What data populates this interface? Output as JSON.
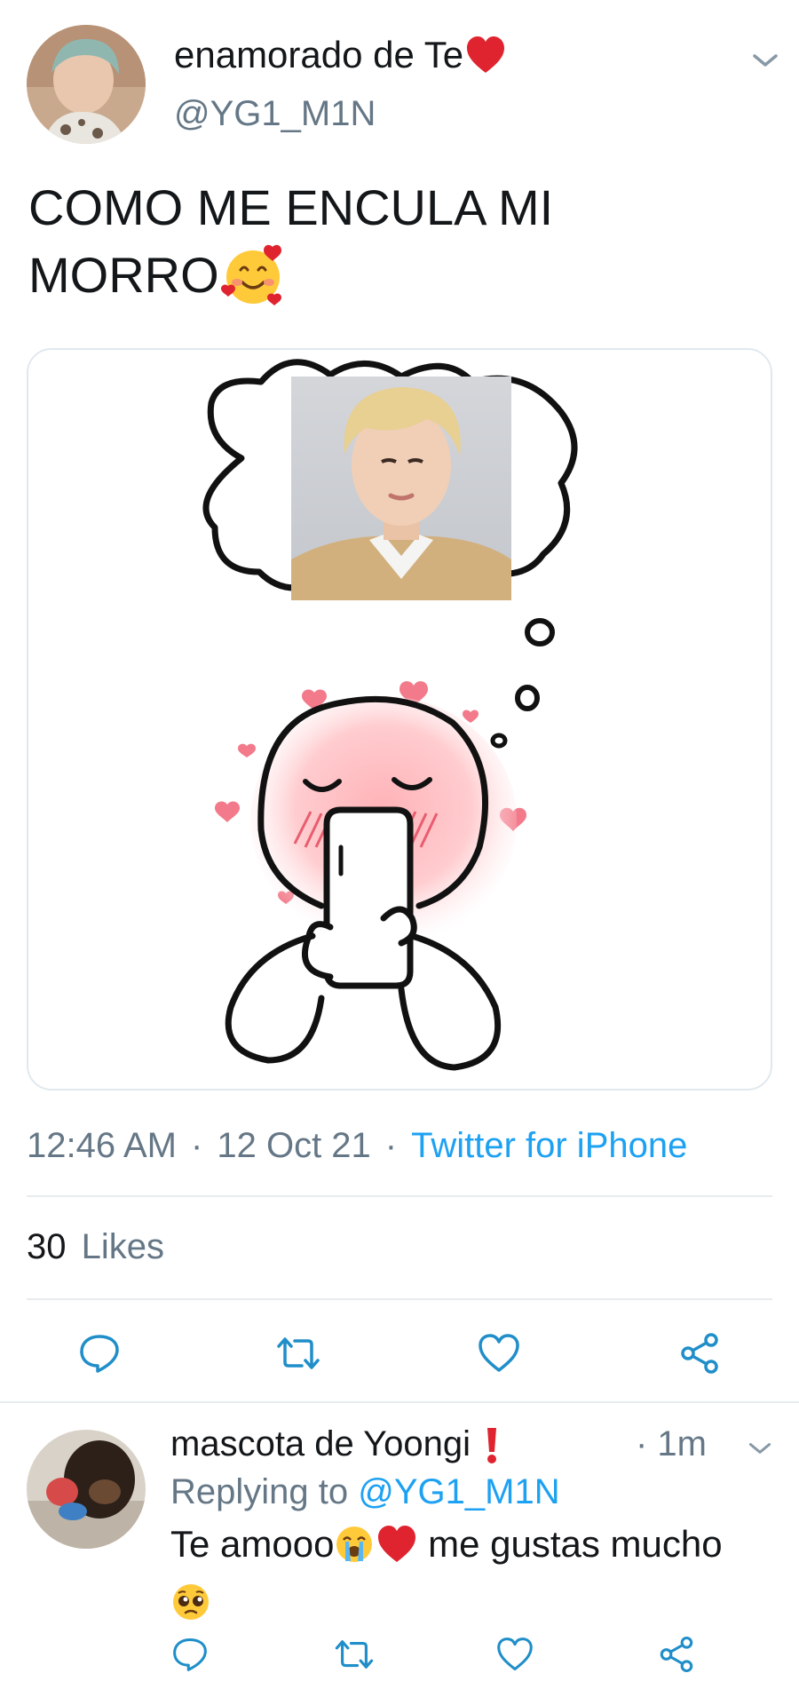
{
  "tweet": {
    "display_name": "enamorado de Te",
    "name_emoji": "red-heart-emoji",
    "handle": "@YG1_M1N",
    "text_line1": "COMO ME ENCULA MI",
    "text_line2": "MORRO",
    "text_emoji": "smiling-face-with-hearts-emoji",
    "time": "12:46 AM",
    "date": "12 Oct 21",
    "separator": "·",
    "source": "Twitter for iPhone",
    "likes_count": "30",
    "likes_label": "Likes"
  },
  "reply": {
    "display_name": "mascota de Yoongi",
    "name_emoji": "exclamation-mark-emoji",
    "time": "· 1m",
    "replying_prefix": "Replying to",
    "replying_handle": "@YG1_M1N",
    "text_part1": "Te amooo",
    "text_part2": " me gustas mucho",
    "text_emojis": [
      "loudly-crying-face-emoji",
      "red-heart-emoji",
      "pleading-face-emoji"
    ]
  },
  "colors": {
    "text": "#14171a",
    "secondary": "#657786",
    "accent": "#1da1f2",
    "divider": "#e6ecf0",
    "icon": "#1f8ec9"
  },
  "icons": [
    "chevron-down-icon",
    "reply-icon",
    "retweet-icon",
    "like-icon",
    "share-icon"
  ]
}
